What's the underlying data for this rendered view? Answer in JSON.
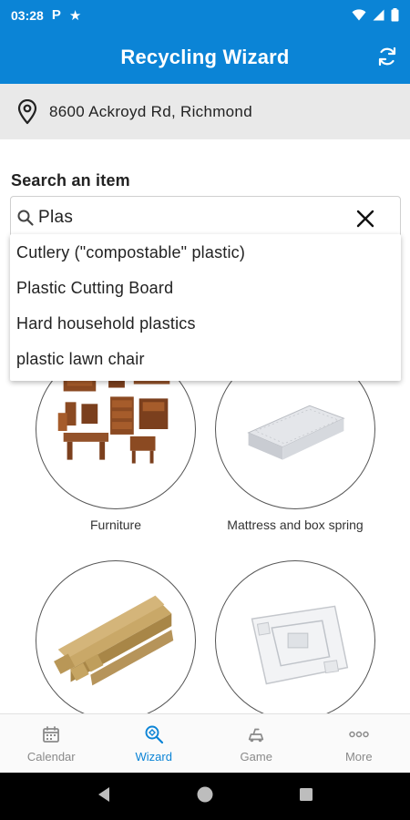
{
  "status_bar": {
    "time": "03:28",
    "notification_letter": "P"
  },
  "app_bar": {
    "title": "Recycling Wizard"
  },
  "address": {
    "text": "8600 Ackroyd Rd, Richmond"
  },
  "search": {
    "label": "Search an item",
    "value": "Plas"
  },
  "suggestions": [
    "Cutlery (\"compostable\" plastic)",
    "Plastic Cutting Board",
    "Hard household plastics",
    "plastic lawn chair"
  ],
  "categories": [
    {
      "label": "Furniture",
      "icon": "furniture-image"
    },
    {
      "label": "Mattress and box spring",
      "icon": "mattress-image"
    },
    {
      "label": "",
      "icon": "lumber-image"
    },
    {
      "label": "",
      "icon": "styrofoam-image"
    }
  ],
  "bottom_nav": {
    "items": [
      {
        "label": "Calendar",
        "icon": "calendar-icon"
      },
      {
        "label": "Wizard",
        "icon": "wizard-icon"
      },
      {
        "label": "Game",
        "icon": "game-icon"
      },
      {
        "label": "More",
        "icon": "more-icon"
      }
    ],
    "active": "Wizard"
  },
  "colors": {
    "primary": "#0b84d6",
    "address_bg": "#e9e9e9",
    "inactive_nav": "#8a8a8a",
    "system_nav": "#000000"
  }
}
